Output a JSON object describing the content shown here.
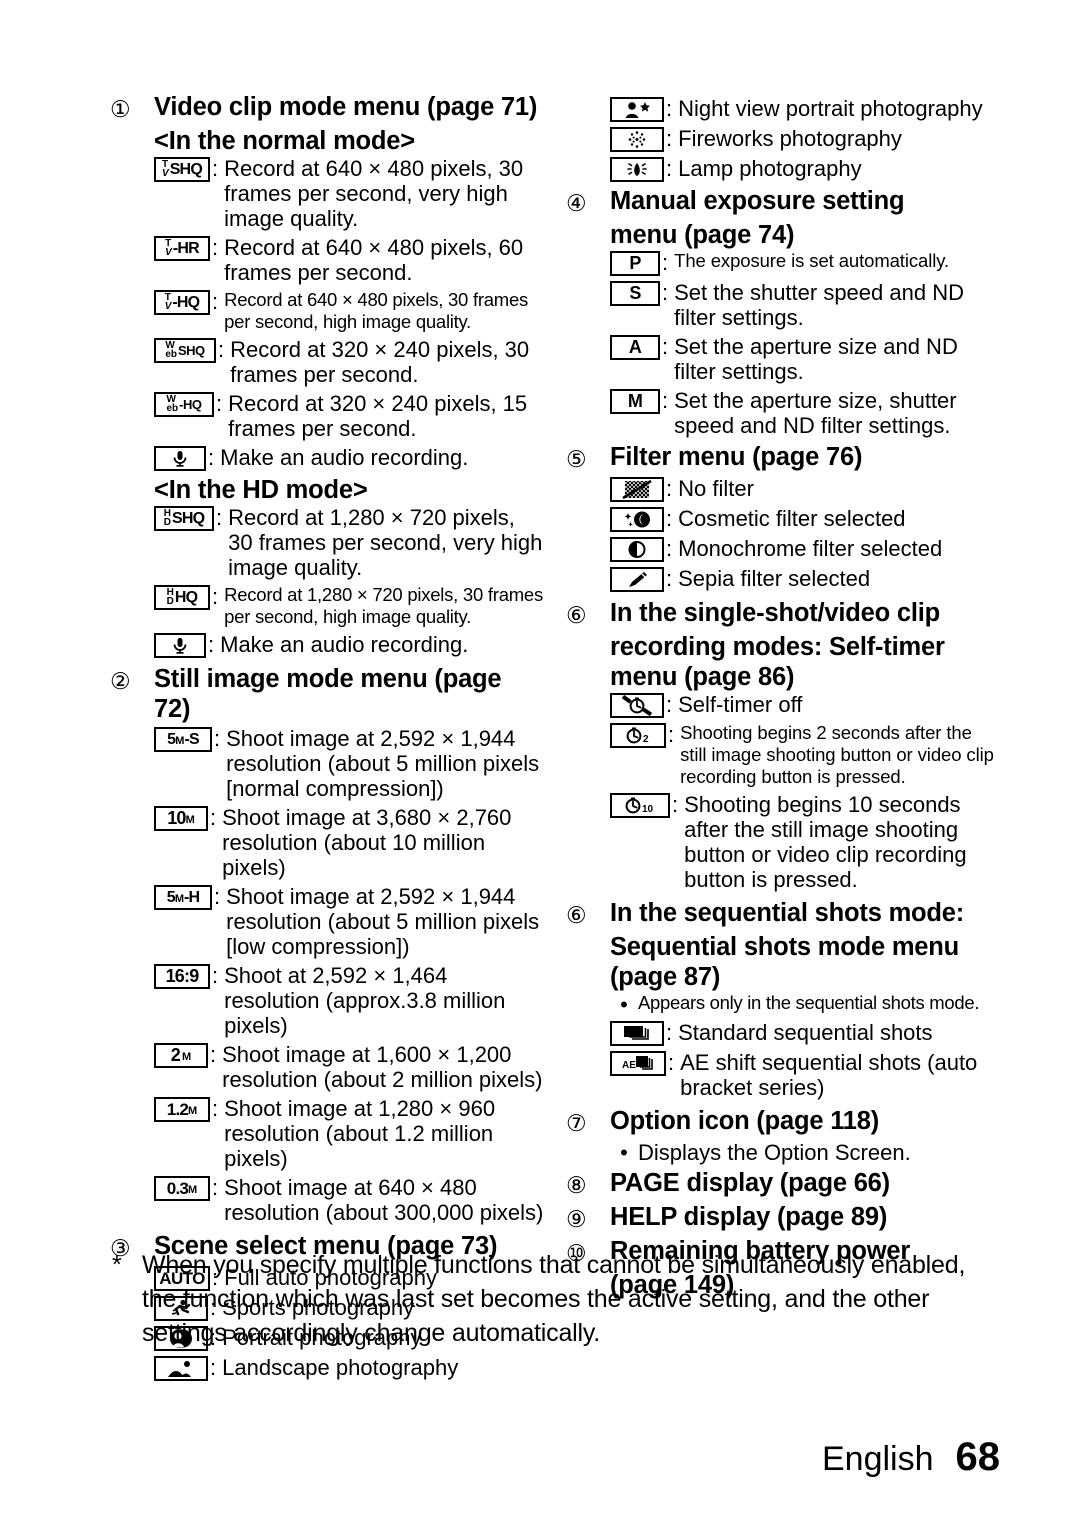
{
  "document": {
    "language_label": "English",
    "page_number": "68"
  },
  "sections": [
    {
      "number": "①",
      "heading_line1": "Video clip mode menu (page 71)",
      "heading_line2": "<In the normal mode>",
      "items": [
        {
          "icon": "tv-shq-icon",
          "icon_label": "Tv-SHQ",
          "text": "Record at 640 × 480 pixels, 30 frames per second, very high image quality.",
          "size": "normal"
        },
        {
          "icon": "tv-hr-icon",
          "icon_label": "Tv-HR",
          "text": "Record at 640 × 480 pixels, 60 frames per second.",
          "size": "normal"
        },
        {
          "icon": "tv-hq-icon",
          "icon_label": "Tv-HQ",
          "text": "Record at 640 × 480 pixels, 30 frames per second, high image quality.",
          "size": "small"
        },
        {
          "icon": "web-shq-icon",
          "icon_label": "WebSHQ",
          "text": "Record at 320 × 240 pixels, 30 frames per second.",
          "size": "normal"
        },
        {
          "icon": "web-hq-icon",
          "icon_label": "WebHQ",
          "text": "Record at 320 × 240 pixels, 15 frames per second.",
          "size": "normal"
        },
        {
          "icon": "microphone-icon",
          "icon_label": "",
          "text": "Make an audio recording.",
          "size": "normal"
        }
      ],
      "subheading": "<In the HD mode>",
      "hd_items": [
        {
          "icon": "hd-shq-icon",
          "icon_label": "HDSHQ",
          "text": "Record at 1,280 × 720 pixels, 30 frames per second, very high image quality.",
          "size": "normal"
        },
        {
          "icon": "hd-hq-icon",
          "icon_label": "HDHQ",
          "text": "Record at 1,280 × 720 pixels, 30 frames per second, high image quality.",
          "size": "small"
        },
        {
          "icon": "microphone-icon",
          "icon_label": "",
          "text": "Make an audio recording.",
          "size": "normal"
        }
      ]
    },
    {
      "number": "②",
      "heading_line1": "Still image mode menu (page 72)",
      "items": [
        {
          "icon": "res-5m-s-icon",
          "icon_label": "5M-S",
          "text": "Shoot image at 2,592 × 1,944 resolution (about 5 million pixels [normal compression])",
          "size": "normal"
        },
        {
          "icon": "res-10m-icon",
          "icon_label": "10M",
          "text": "Shoot image at 3,680 × 2,760 resolution (about 10 million pixels)",
          "size": "normal"
        },
        {
          "icon": "res-5m-h-icon",
          "icon_label": "5M-H",
          "text": "Shoot image at 2,592 × 1,944 resolution (about 5 million pixels [low compression])",
          "size": "normal"
        },
        {
          "icon": "res-16-9-icon",
          "icon_label": "16:9",
          "text": "Shoot at 2,592 × 1,464 resolution (approx.3.8 million pixels)",
          "size": "normal"
        },
        {
          "icon": "res-2m-icon",
          "icon_label": "2M",
          "text": "Shoot image at 1,600 × 1,200 resolution (about 2 million pixels)",
          "size": "normal"
        },
        {
          "icon": "res-1-2m-icon",
          "icon_label": "1.2M",
          "text": "Shoot image at 1,280 × 960 resolution (about 1.2 million pixels)",
          "size": "normal"
        },
        {
          "icon": "res-0-3m-icon",
          "icon_label": "0.3M",
          "text": "Shoot image at 640 × 480 resolution (about 300,000 pixels)",
          "size": "normal"
        }
      ]
    },
    {
      "number": "③",
      "heading_line1": "Scene select menu (page 73)",
      "items": [
        {
          "icon": "auto-icon",
          "icon_label": "AUTO",
          "text": "Full auto photography",
          "size": "normal"
        },
        {
          "icon": "sports-icon",
          "icon_label": "",
          "text": "Sports photography",
          "size": "normal"
        },
        {
          "icon": "portrait-icon",
          "icon_label": "",
          "text": "Portrait photography",
          "size": "normal"
        },
        {
          "icon": "landscape-icon",
          "icon_label": "",
          "text": "Landscape photography",
          "size": "normal"
        },
        {
          "icon": "night-view-portrait-icon",
          "icon_label": "",
          "text": "Night view portrait photography",
          "size": "normal"
        },
        {
          "icon": "fireworks-icon",
          "icon_label": "",
          "text": "Fireworks photography",
          "size": "normal"
        },
        {
          "icon": "lamp-icon",
          "icon_label": "",
          "text": "Lamp photography",
          "size": "normal"
        }
      ]
    },
    {
      "number": "④",
      "heading_line1": "Manual exposure setting",
      "heading_line2": "menu (page 74)",
      "items": [
        {
          "icon": "program-p-icon",
          "icon_label": "P",
          "text": "The exposure is set automatically.",
          "size": "normal"
        },
        {
          "icon": "shutter-s-icon",
          "icon_label": "S",
          "text": "Set the shutter speed and ND filter settings.",
          "size": "normal"
        },
        {
          "icon": "aperture-a-icon",
          "icon_label": "A",
          "text": "Set the aperture size and ND filter settings.",
          "size": "normal"
        },
        {
          "icon": "manual-m-icon",
          "icon_label": "M",
          "text": "Set the aperture size, shutter speed and ND filter settings.",
          "size": "normal"
        }
      ]
    },
    {
      "number": "⑤",
      "heading_line1": "Filter menu (page 76)",
      "items": [
        {
          "icon": "no-filter-icon",
          "icon_label": "",
          "text": "No filter",
          "size": "normal"
        },
        {
          "icon": "cosmetic-filter-icon",
          "icon_label": "",
          "text": "Cosmetic filter selected",
          "size": "normal"
        },
        {
          "icon": "monochrome-filter-icon",
          "icon_label": "",
          "text": "Monochrome filter selected",
          "size": "normal"
        },
        {
          "icon": "sepia-filter-icon",
          "icon_label": "",
          "text": "Sepia filter selected",
          "size": "normal"
        }
      ]
    },
    {
      "number": "⑥",
      "heading_line1": "In the single-shot/video clip",
      "heading_line2": "recording modes: Self-timer",
      "heading_line3": "menu (page 86)",
      "items": [
        {
          "icon": "self-timer-off-icon",
          "icon_label": "",
          "text": "Self-timer off",
          "size": "normal"
        },
        {
          "icon": "self-timer-2s-icon",
          "icon_label": "2",
          "text": "Shooting begins 2 seconds after the still image shooting button or video clip recording button is pressed.",
          "size": "small"
        },
        {
          "icon": "self-timer-10s-icon",
          "icon_label": "10",
          "text": "Shooting begins 10 seconds after the still image shooting button or video clip recording button is pressed.",
          "size": "normal"
        }
      ]
    },
    {
      "number": "⑥",
      "heading_line1": "In the sequential shots mode:",
      "heading_line2": "Sequential shots mode menu",
      "heading_line3": "(page 87)",
      "bullets": [
        {
          "text": "Appears only in the sequential shots mode.",
          "size": "small"
        }
      ],
      "items": [
        {
          "icon": "standard-sequential-icon",
          "icon_label": "",
          "text": "Standard sequential shots",
          "size": "normal"
        },
        {
          "icon": "ae-shift-sequential-icon",
          "icon_label": "AE",
          "text": "AE shift sequential shots (auto bracket series)",
          "size": "normal"
        }
      ]
    },
    {
      "number": "⑦",
      "heading_line1": "Option icon (page 118)",
      "bullets": [
        {
          "text": "Displays the Option Screen.",
          "size": "normal"
        }
      ]
    },
    {
      "number": "⑧",
      "heading_line1": "PAGE display (page 66)"
    },
    {
      "number": "⑨",
      "heading_line1": "HELP display (page 89)"
    },
    {
      "number": "⑩",
      "heading_line1": "Remaining battery power",
      "heading_line2": "(page 149)"
    }
  ],
  "footnote": {
    "marker": "*",
    "text": "When you specify multiple functions that cannot be simultaneously enabled, the function which was last set becomes the active setting, and the other settings accordingly change automatically."
  }
}
